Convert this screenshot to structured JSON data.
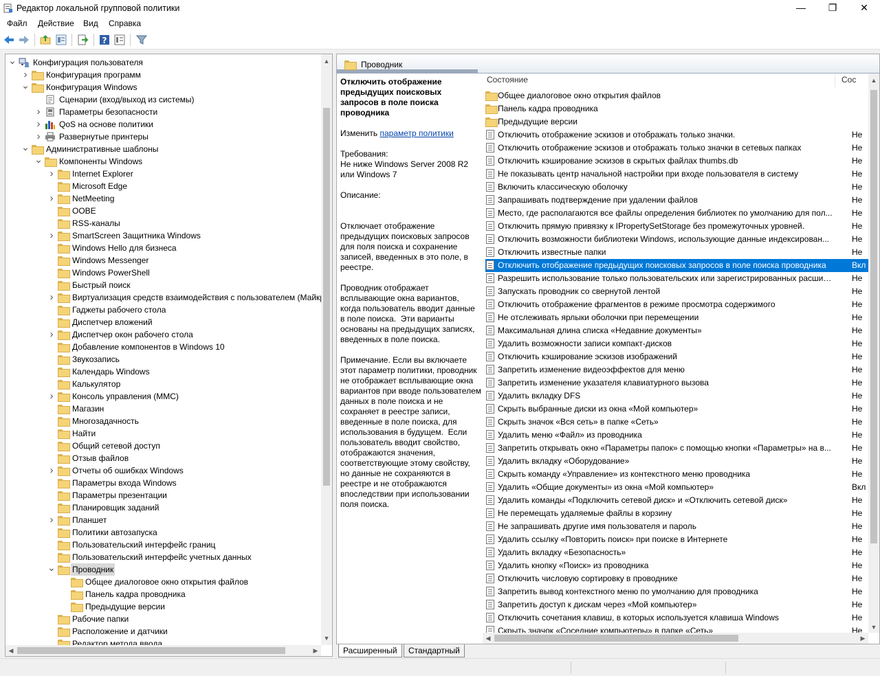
{
  "window": {
    "title": "Редактор локальной групповой политики",
    "minimize": "—",
    "maximize": "❐",
    "close": "✕"
  },
  "menu": [
    "Файл",
    "Действие",
    "Вид",
    "Справка"
  ],
  "tree": [
    {
      "label": "Конфигурация пользователя",
      "level": 0,
      "exp": "collapse",
      "icon": "computer"
    },
    {
      "label": "Конфигурация программ",
      "level": 1,
      "exp": "expand",
      "icon": "folder"
    },
    {
      "label": "Конфигурация Windows",
      "level": 1,
      "exp": "collapse",
      "icon": "folder"
    },
    {
      "label": "Сценарии (вход/выход из системы)",
      "level": 2,
      "exp": "",
      "icon": "script"
    },
    {
      "label": "Параметры безопасности",
      "level": 2,
      "exp": "expand",
      "icon": "security"
    },
    {
      "label": "QoS на основе политики",
      "level": 2,
      "exp": "expand",
      "icon": "chart"
    },
    {
      "label": "Развернутые принтеры",
      "level": 2,
      "exp": "expand",
      "icon": "printer"
    },
    {
      "label": "Административные шаблоны",
      "level": 1,
      "exp": "collapse",
      "icon": "folder"
    },
    {
      "label": "Компоненты Windows",
      "level": 2,
      "exp": "collapse",
      "icon": "folder"
    },
    {
      "label": "Internet Explorer",
      "level": 3,
      "exp": "expand",
      "icon": "folder"
    },
    {
      "label": "Microsoft Edge",
      "level": 3,
      "exp": "",
      "icon": "folder"
    },
    {
      "label": "NetMeeting",
      "level": 3,
      "exp": "expand",
      "icon": "folder"
    },
    {
      "label": "OOBE",
      "level": 3,
      "exp": "",
      "icon": "folder"
    },
    {
      "label": "RSS-каналы",
      "level": 3,
      "exp": "",
      "icon": "folder"
    },
    {
      "label": "SmartScreen Защитника Windows",
      "level": 3,
      "exp": "expand",
      "icon": "folder"
    },
    {
      "label": "Windows Hello для бизнеса",
      "level": 3,
      "exp": "",
      "icon": "folder"
    },
    {
      "label": "Windows Messenger",
      "level": 3,
      "exp": "",
      "icon": "folder"
    },
    {
      "label": "Windows PowerShell",
      "level": 3,
      "exp": "",
      "icon": "folder"
    },
    {
      "label": "Быстрый поиск",
      "level": 3,
      "exp": "",
      "icon": "folder"
    },
    {
      "label": "Виртуализация средств взаимодействия с пользователем (Майкр",
      "level": 3,
      "exp": "expand",
      "icon": "folder"
    },
    {
      "label": "Гаджеты рабочего стола",
      "level": 3,
      "exp": "",
      "icon": "folder"
    },
    {
      "label": "Диспетчер вложений",
      "level": 3,
      "exp": "",
      "icon": "folder"
    },
    {
      "label": "Диспетчер окон рабочего стола",
      "level": 3,
      "exp": "expand",
      "icon": "folder"
    },
    {
      "label": "Добавление компонентов в Windows 10",
      "level": 3,
      "exp": "",
      "icon": "folder"
    },
    {
      "label": "Звукозапись",
      "level": 3,
      "exp": "",
      "icon": "folder"
    },
    {
      "label": "Календарь Windows",
      "level": 3,
      "exp": "",
      "icon": "folder"
    },
    {
      "label": "Калькулятор",
      "level": 3,
      "exp": "",
      "icon": "folder"
    },
    {
      "label": "Консоль управления (MMC)",
      "level": 3,
      "exp": "expand",
      "icon": "folder"
    },
    {
      "label": "Магазин",
      "level": 3,
      "exp": "",
      "icon": "folder"
    },
    {
      "label": "Многозадачность",
      "level": 3,
      "exp": "",
      "icon": "folder"
    },
    {
      "label": "Найти",
      "level": 3,
      "exp": "",
      "icon": "folder"
    },
    {
      "label": "Общий сетевой доступ",
      "level": 3,
      "exp": "",
      "icon": "folder"
    },
    {
      "label": "Отзыв файлов",
      "level": 3,
      "exp": "",
      "icon": "folder"
    },
    {
      "label": "Отчеты об ошибках Windows",
      "level": 3,
      "exp": "expand",
      "icon": "folder"
    },
    {
      "label": "Параметры входа Windows",
      "level": 3,
      "exp": "",
      "icon": "folder"
    },
    {
      "label": "Параметры презентации",
      "level": 3,
      "exp": "",
      "icon": "folder"
    },
    {
      "label": "Планировщик заданий",
      "level": 3,
      "exp": "",
      "icon": "folder"
    },
    {
      "label": "Планшет",
      "level": 3,
      "exp": "expand",
      "icon": "folder"
    },
    {
      "label": "Политики автозапуска",
      "level": 3,
      "exp": "",
      "icon": "folder"
    },
    {
      "label": "Пользовательский интерфейс границ",
      "level": 3,
      "exp": "",
      "icon": "folder"
    },
    {
      "label": "Пользовательский интерфейс учетных данных",
      "level": 3,
      "exp": "",
      "icon": "folder"
    },
    {
      "label": "Проводник",
      "level": 3,
      "exp": "collapse",
      "icon": "folder",
      "selected": true
    },
    {
      "label": "Общее диалоговое окно открытия файлов",
      "level": 4,
      "exp": "",
      "icon": "folder"
    },
    {
      "label": "Панель кадра проводника",
      "level": 4,
      "exp": "",
      "icon": "folder"
    },
    {
      "label": "Предыдущие версии",
      "level": 4,
      "exp": "",
      "icon": "folder"
    },
    {
      "label": "Рабочие папки",
      "level": 3,
      "exp": "",
      "icon": "folder"
    },
    {
      "label": "Расположение и датчики",
      "level": 3,
      "exp": "",
      "icon": "folder"
    },
    {
      "label": "Редактор метода ввода",
      "level": 3,
      "exp": "",
      "icon": "folder"
    }
  ],
  "right": {
    "header_title": "Проводник",
    "desc": {
      "title": "Отключить отображение предыдущих поисковых запросов в поле поиска проводника",
      "edit_prefix": "Изменить ",
      "edit_link": "параметр политики",
      "requirements": "Требования:\nНе ниже Windows Server 2008 R2 или Windows 7",
      "description_label": "Описание:",
      "p1": "Отключает отображение предыдущих поисковых запросов для поля поиска и сохранение записей, введенных в это поле, в реестре.",
      "p2": "Проводник отображает всплывающие окна вариантов, когда пользователь вводит данные в поле поиска.  Эти варианты основаны на предыдущих записях, введенных в поле поиска.",
      "p3": "Примечание. Если вы включаете этот параметр политики, проводник не отображает всплывающие окна вариантов при вводе пользователем данных в поле поиска и не сохраняет в реестре записи, введенные в поле поиска, для использования в будущем.  Если пользователь вводит свойство, отображаются значения, соответствующие этому свойству, но данные не сохраняются в реестре и не отображаются впоследствии при использовании поля поиска."
    },
    "columns": {
      "state_name": "Состояние",
      "state_short": "Сос"
    },
    "items": [
      {
        "label": "Общее диалоговое окно открытия файлов",
        "state": "",
        "icon": "folder"
      },
      {
        "label": "Панель кадра проводника",
        "state": "",
        "icon": "folder"
      },
      {
        "label": "Предыдущие версии",
        "state": "",
        "icon": "folder"
      },
      {
        "label": "Отключить отображение эскизов и отображать только значки.",
        "state": "Не",
        "icon": "policy"
      },
      {
        "label": "Отключить отображение эскизов и отображать только значки в сетевых папках",
        "state": "Не",
        "icon": "policy"
      },
      {
        "label": "Отключить кэширование эскизов в скрытых файлах thumbs.db",
        "state": "Не",
        "icon": "policy"
      },
      {
        "label": "Не показывать центр начальной настройки при входе пользователя в систему",
        "state": "Не",
        "icon": "policy"
      },
      {
        "label": "Включить классическую оболочку",
        "state": "Не",
        "icon": "policy"
      },
      {
        "label": "Запрашивать подтверждение при удалении файлов",
        "state": "Не",
        "icon": "policy"
      },
      {
        "label": "Место, где располагаются все файлы определения библиотек по умолчанию для пол...",
        "state": "Не",
        "icon": "policy"
      },
      {
        "label": "Отключить прямую привязку к IPropertySetStorage без промежуточных уровней.",
        "state": "Не",
        "icon": "policy"
      },
      {
        "label": "Отключить возможности библиотеки Windows, использующие данные индексирован...",
        "state": "Не",
        "icon": "policy"
      },
      {
        "label": "Отключить известные папки",
        "state": "Не",
        "icon": "policy"
      },
      {
        "label": "Отключить отображение предыдущих поисковых запросов в поле поиска проводника",
        "state": "Вкл",
        "icon": "policy",
        "selected": true
      },
      {
        "label": "Разрешить использование только пользовательских или зарегистрированных расшир...",
        "state": "Не",
        "icon": "policy"
      },
      {
        "label": "Запускать проводник со свернутой лентой",
        "state": "Не",
        "icon": "policy"
      },
      {
        "label": "Отключить отображение фрагментов в режиме просмотра содержимого",
        "state": "Не",
        "icon": "policy"
      },
      {
        "label": "Не отслеживать ярлыки оболочки при перемещении",
        "state": "Не",
        "icon": "policy"
      },
      {
        "label": "Максимальная длина списка «Недавние документы»",
        "state": "Не",
        "icon": "policy"
      },
      {
        "label": "Удалить возможности записи компакт-дисков",
        "state": "Не",
        "icon": "policy"
      },
      {
        "label": "Отключить кэширование эскизов изображений",
        "state": "Не",
        "icon": "policy"
      },
      {
        "label": "Запретить изменение видеоэффектов для меню",
        "state": "Не",
        "icon": "policy"
      },
      {
        "label": "Запретить изменение указателя клавиатурного вызова",
        "state": "Не",
        "icon": "policy"
      },
      {
        "label": "Удалить вкладку DFS",
        "state": "Не",
        "icon": "policy"
      },
      {
        "label": "Скрыть выбранные диски из окна «Мой компьютер»",
        "state": "Не",
        "icon": "policy"
      },
      {
        "label": "Скрыть значок «Вся сеть» в папке «Сеть»",
        "state": "Не",
        "icon": "policy"
      },
      {
        "label": "Удалить меню «Файл» из проводника",
        "state": "Не",
        "icon": "policy"
      },
      {
        "label": "Запретить открывать окно «Параметры папок» с помощью кнопки «Параметры» на в...",
        "state": "Не",
        "icon": "policy"
      },
      {
        "label": "Удалить вкладку «Оборудование»",
        "state": "Не",
        "icon": "policy"
      },
      {
        "label": "Скрыть команду «Управление» из контекстного меню проводника",
        "state": "Не",
        "icon": "policy"
      },
      {
        "label": "Удалить «Общие документы» из окна «Мой компьютер»",
        "state": "Вкл",
        "icon": "policy"
      },
      {
        "label": "Удалить команды «Подключить сетевой диск» и «Отключить сетевой диск»",
        "state": "Не",
        "icon": "policy"
      },
      {
        "label": "Не перемещать удаляемые файлы в корзину",
        "state": "Не",
        "icon": "policy"
      },
      {
        "label": "Не запрашивать другие имя пользователя и пароль",
        "state": "Не",
        "icon": "policy"
      },
      {
        "label": "Удалить ссылку «Повторить поиск» при поиске в Интернете",
        "state": "Не",
        "icon": "policy"
      },
      {
        "label": "Удалить вкладку «Безопасность»",
        "state": "Не",
        "icon": "policy"
      },
      {
        "label": "Удалить кнопку «Поиск» из проводника",
        "state": "Не",
        "icon": "policy"
      },
      {
        "label": "Отключить числовую сортировку в проводнике",
        "state": "Не",
        "icon": "policy"
      },
      {
        "label": "Запретить вывод контекстного меню по умолчанию для проводника",
        "state": "Не",
        "icon": "policy"
      },
      {
        "label": "Запретить доступ к дискам через «Мой компьютер»",
        "state": "Не",
        "icon": "policy"
      },
      {
        "label": "Отключить сочетания клавиш, в которых используется клавиша Windows",
        "state": "Не",
        "icon": "policy"
      },
      {
        "label": "Скрыть значок «Соседние компьютеры» в папке «Сеть»",
        "state": "Не",
        "icon": "policy"
      }
    ]
  },
  "tabs": [
    "Расширенный",
    "Стандартный"
  ]
}
